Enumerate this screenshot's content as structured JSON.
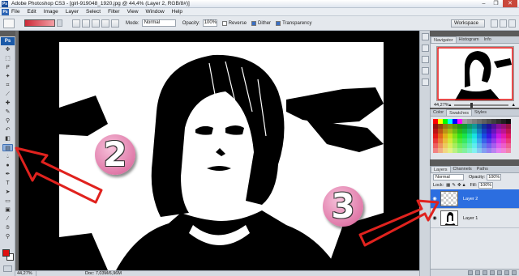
{
  "window": {
    "title": "Adobe Photoshop CS3 - [girl-919048_1920.jpg @ 44,4% (Layer 2, RGB/8#)]",
    "ps_badge": "Ps"
  },
  "menu": {
    "items": [
      "File",
      "Edit",
      "Image",
      "Layer",
      "Select",
      "Filter",
      "View",
      "Window",
      "Help"
    ]
  },
  "options_bar": {
    "mode_label": "Mode:",
    "mode_value": "Normal",
    "opacity_label": "Opacity:",
    "opacity_value": "100%",
    "reverse_label": "Reverse",
    "dither_label": "Dither",
    "transparency_label": "Transparency",
    "workspace_label": "Workspace"
  },
  "tools": {
    "ps_label": "Ps",
    "foreground_color": "#e01010",
    "background_color": "#ffffff"
  },
  "navigator": {
    "tabs": [
      "Navigator",
      "Histogram",
      "Info"
    ],
    "zoom": "44,27%"
  },
  "swatches": {
    "tabs": [
      "Color",
      "Swatches",
      "Styles"
    ]
  },
  "layers": {
    "tabs": [
      "Layers",
      "Channels",
      "Paths"
    ],
    "blend_mode": "Normal",
    "opacity_label": "Opacity:",
    "opacity_value": "100%",
    "lock_label": "Lock:",
    "fill_label": "Fill:",
    "fill_value": "100%",
    "items": [
      {
        "name": "Layer 2",
        "selected": true
      },
      {
        "name": "Layer 1",
        "selected": false
      }
    ]
  },
  "status": {
    "zoom": "44,27%",
    "doc": "Doc: 7,03M/6,96M"
  },
  "annotations": {
    "step_two": "2",
    "step_three": "3",
    "arrow_color": "#e0221e"
  }
}
